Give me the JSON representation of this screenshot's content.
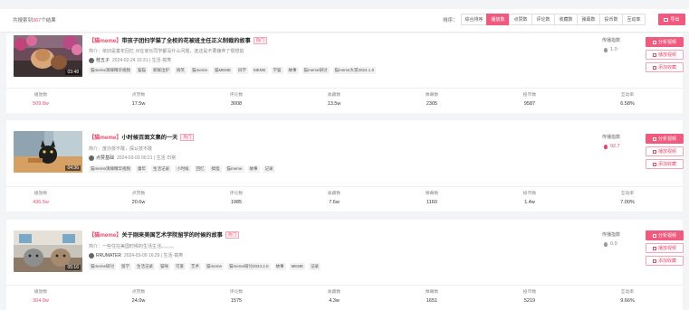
{
  "toolbar": {
    "total_prefix": "共搜索到",
    "total_count": "367",
    "total_suffix": "个结果",
    "sort_label": "排序：",
    "sort_options": [
      "综合排序",
      "播放数",
      "点赞数",
      "评论数",
      "收藏数",
      "弹幕数",
      "投币数",
      "互动率"
    ],
    "active_sort": "播放数",
    "export_label": "导出"
  },
  "labels": {
    "desc_prefix": "简介：",
    "score": "传播指数",
    "analyze": "分析视频",
    "play": "播放视频",
    "favorite": "添加收藏",
    "stats": [
      "播放数",
      "点赞数",
      "评论数",
      "收藏数",
      "弹幕数",
      "投币数",
      "互动率"
    ]
  },
  "cards": [
    {
      "meme": "【猫meme】",
      "title": "带孩子团扫学猫了全校的花被班主任正义制裁的故事",
      "badge": "热门",
      "desc": "依旧是童年回忆 对在家长同学都没什么问题，连还是不要嫌弃了很想拍",
      "author": "桂五子",
      "meta": "2024-02-24 10:31 | 生活·搞笑",
      "tags": [
        "猫meme演绎精华视频",
        "猫猫",
        "新鲜出炉",
        "搞笑",
        "猫meme",
        "猫MEME",
        "同学",
        "MEME",
        "学猫",
        "故事",
        "猫meme研讨",
        "猫meme大赏2024.1.0"
      ],
      "duration": "03:48",
      "score": "1.0",
      "hot": false,
      "stats": [
        "509.8w",
        "17.5w",
        "3008",
        "13.5w",
        "2305",
        "9587",
        "6.58%"
      ]
    },
    {
      "meme": "【猫meme】",
      "title": "小时候百面文集的一天",
      "badge": "热门",
      "desc": "度办技不敢，探认技不敢",
      "author": "点赞基础",
      "meta": "2024-03-03 00:21 | 生活·日常",
      "tags": [
        "猫meme演绎精华视频",
        "童年",
        "生活记录",
        "小时候",
        "回忆",
        "搞怪",
        "猫meme",
        "故事",
        "记录"
      ],
      "duration": "04:36",
      "score": "92.7",
      "hot": true,
      "stats": [
        "436.5w",
        "20.6w",
        "1985",
        "7.6w",
        "1160",
        "1.4w",
        "7.00%"
      ]
    },
    {
      "meme": "【猫meme】",
      "title": "关于刚来美国艺术学院留学的时候的故事",
      "badge": "热门",
      "desc": "一些住在美国时候的生活生活。。。。。。",
      "author": "RRUMATER",
      "meta": "2024-03-09 16:29 | 生活·搞笑",
      "tags": [
        "猫meme研讨",
        "留学",
        "生活记录",
        "猫咪",
        "可爱",
        "艺术",
        "猫meme",
        "猫meme研讨2024.2.0",
        "故事",
        "MEME",
        "记录"
      ],
      "duration": "05:16",
      "score": "0.9",
      "hot": false,
      "stats": [
        "304.0w",
        "24.0w",
        "1575",
        "4.3w",
        "1651",
        "5219",
        "9.66%"
      ]
    }
  ]
}
